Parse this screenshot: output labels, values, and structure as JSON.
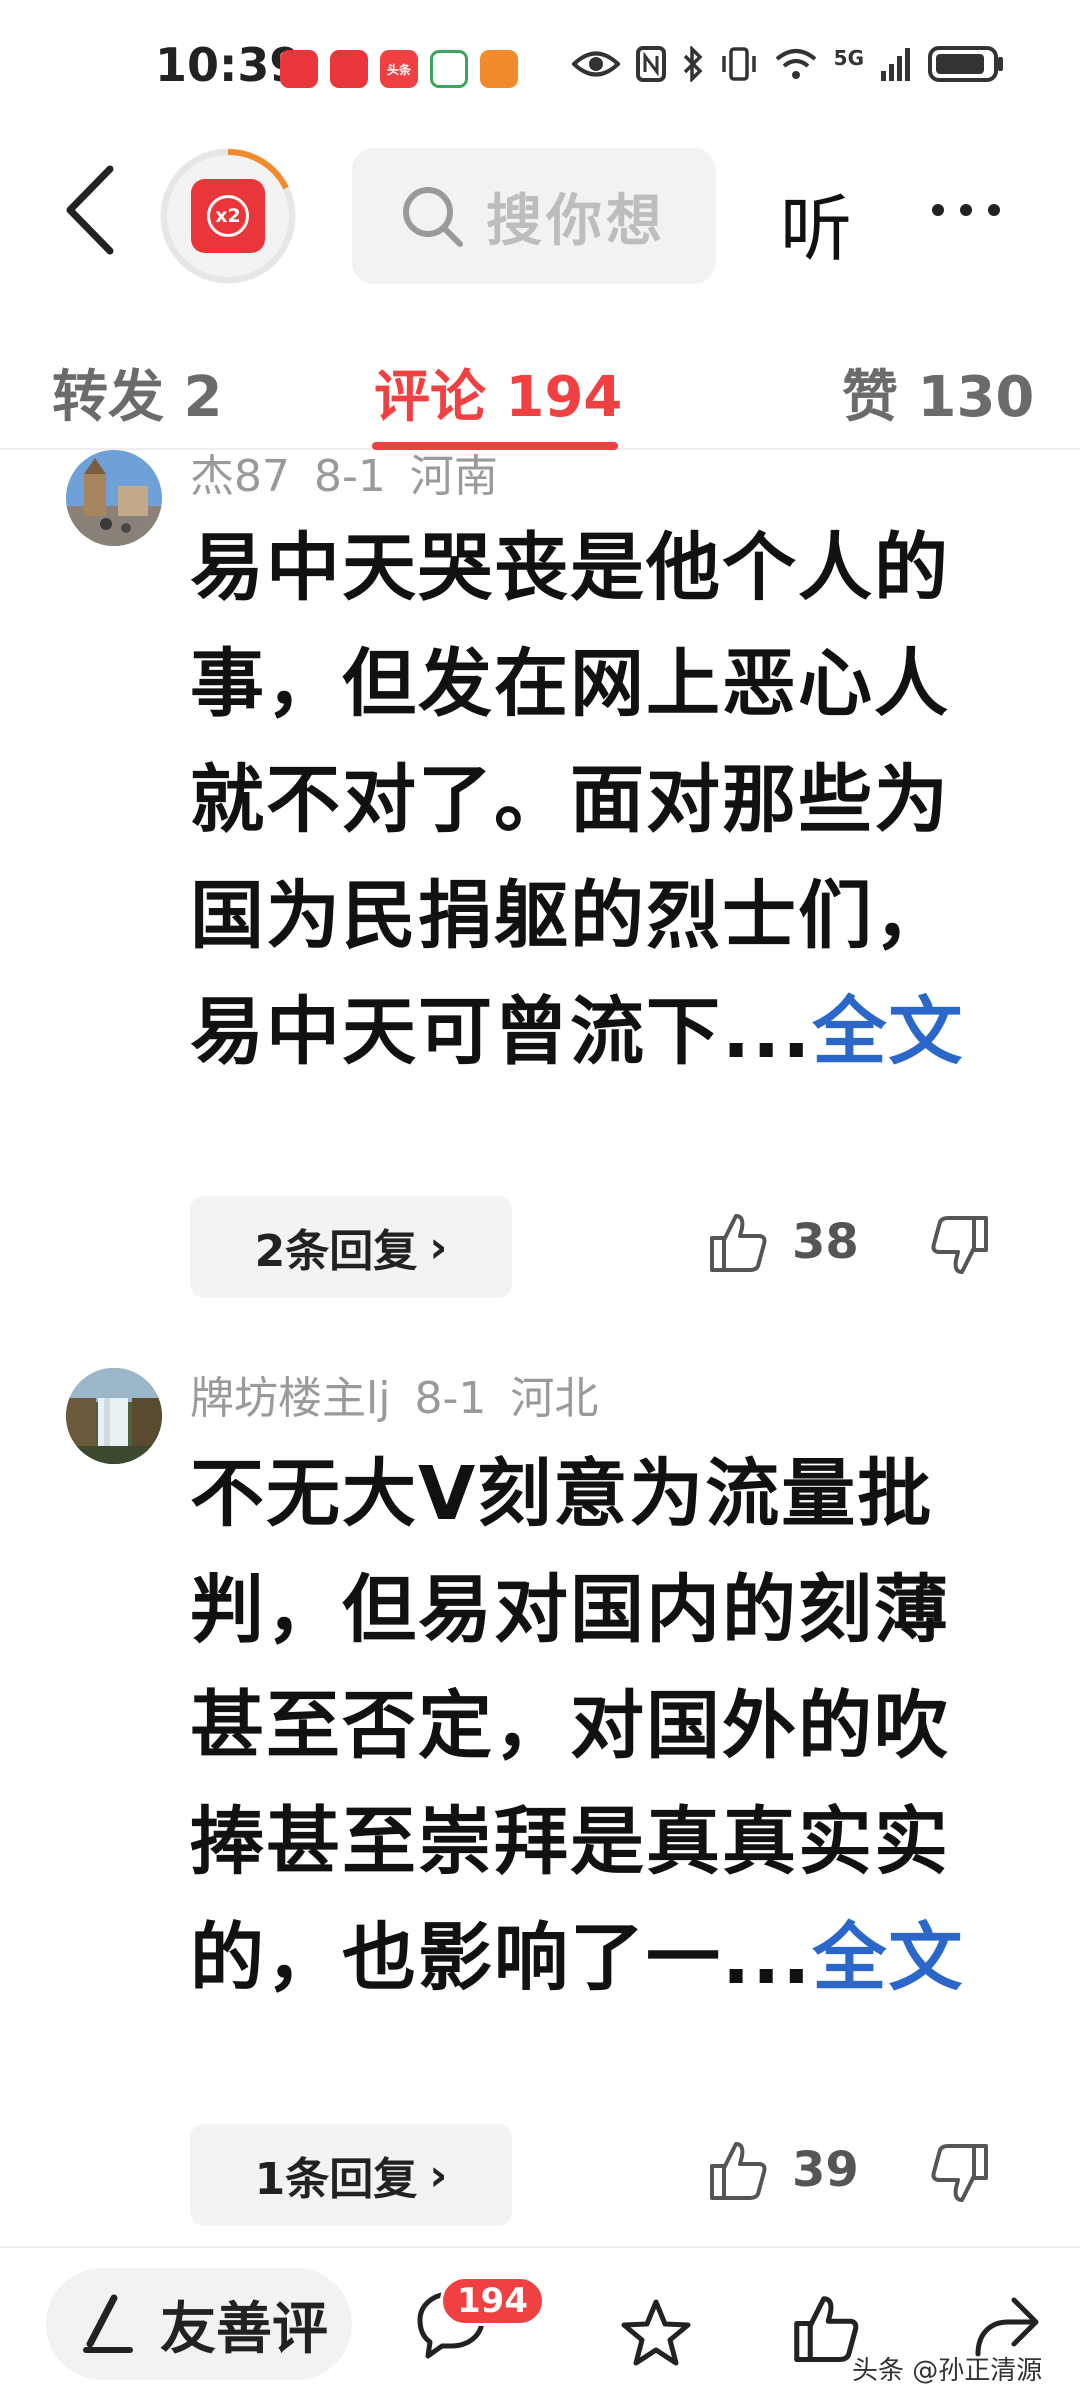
{
  "status_bar": {
    "time": "10:39",
    "network": "5G",
    "app_icons": [
      {
        "name": "huawei-mall-icon",
        "text": "HUAWEI",
        "color": "#e8363a"
      },
      {
        "name": "huawei-mall-icon",
        "text": "HUAWEI",
        "color": "#e8363a"
      },
      {
        "name": "toutiao-icon",
        "text": "头条",
        "color": "#f04142"
      },
      {
        "name": "wallet-icon",
        "text": "",
        "color": "#3aa55b"
      },
      {
        "name": "health-icon",
        "text": "",
        "color": "#f08a2b"
      }
    ]
  },
  "header": {
    "redpack_badge": "x2",
    "search_placeholder": "搜你想",
    "listen_label": "听"
  },
  "tabs": [
    {
      "label": "转发 2"
    },
    {
      "label": "评论 194"
    },
    {
      "label": "赞 130"
    }
  ],
  "comments": [
    {
      "username": "杰87",
      "date": "8-1",
      "location": "河南",
      "text": "易中天哭丧是他个人的事，但发在网上恶心人就不对了。面对那些为国为民捐躯的烈士们，易中天可曾流下...",
      "more_label": "全文",
      "replies_label": "2条回复",
      "likes": "38"
    },
    {
      "username": "牌坊楼主lj",
      "date": "8-1",
      "location": "河北",
      "text": "不无大V刻意为流量批判，但易对国内的刻薄甚至否定，对国外的吹捧甚至崇拜是真真实实的，也影响了一...",
      "more_label": "全文",
      "replies_label": "1条回复",
      "likes": "39"
    }
  ],
  "bottom_bar": {
    "compose_label": "友善评",
    "comment_count": "194"
  },
  "watermark": "头条 @孙正清源",
  "colors": {
    "accent": "#f04142",
    "link": "#2a67c9"
  }
}
